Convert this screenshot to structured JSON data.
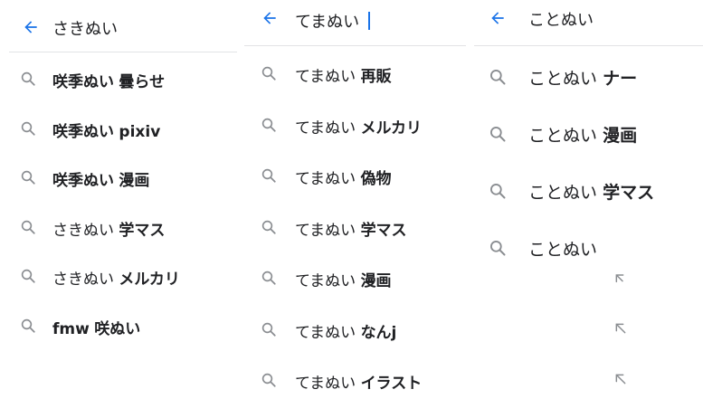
{
  "colors": {
    "accent": "#1a73e8",
    "icon_gray": "#8a8d91",
    "text": "#202124",
    "divider": "#e2e3e5"
  },
  "panels": [
    {
      "query": "さきぬい",
      "suggestions": [
        {
          "base": "咲季ぬい",
          "base_bold": true,
          "suffix": "曇らせ"
        },
        {
          "base": "咲季ぬい",
          "base_bold": true,
          "suffix": "pixiv"
        },
        {
          "base": "咲季ぬい",
          "base_bold": true,
          "suffix": "漫画"
        },
        {
          "base": "さきぬい",
          "base_bold": false,
          "suffix": "学マス"
        },
        {
          "base": "さきぬい",
          "base_bold": false,
          "suffix": "メルカリ"
        },
        {
          "base": "fmw",
          "base_bold": true,
          "suffix": "咲ぬい"
        }
      ]
    },
    {
      "query": "てまぬい",
      "suggestions": [
        {
          "base": "てまぬい",
          "base_bold": false,
          "suffix": "再販"
        },
        {
          "base": "てまぬい",
          "base_bold": false,
          "suffix": "メルカリ"
        },
        {
          "base": "てまぬい",
          "base_bold": false,
          "suffix": "偽物"
        },
        {
          "base": "てまぬい",
          "base_bold": false,
          "suffix": "学マス"
        },
        {
          "base": "てまぬい",
          "base_bold": false,
          "suffix": "漫画"
        },
        {
          "base": "てまぬい",
          "base_bold": false,
          "suffix": "なんj"
        },
        {
          "base": "てまぬい",
          "base_bold": false,
          "suffix": "イラスト"
        }
      ]
    },
    {
      "query": "ことぬい",
      "suggestions": [
        {
          "base": "ことぬい",
          "base_bold": false,
          "suffix": "ナー"
        },
        {
          "base": "ことぬい",
          "base_bold": false,
          "suffix": "漫画"
        },
        {
          "base": "ことぬい",
          "base_bold": false,
          "suffix": "学マス"
        },
        {
          "base": "ことぬい",
          "base_bold": false,
          "suffix": ""
        }
      ]
    }
  ]
}
